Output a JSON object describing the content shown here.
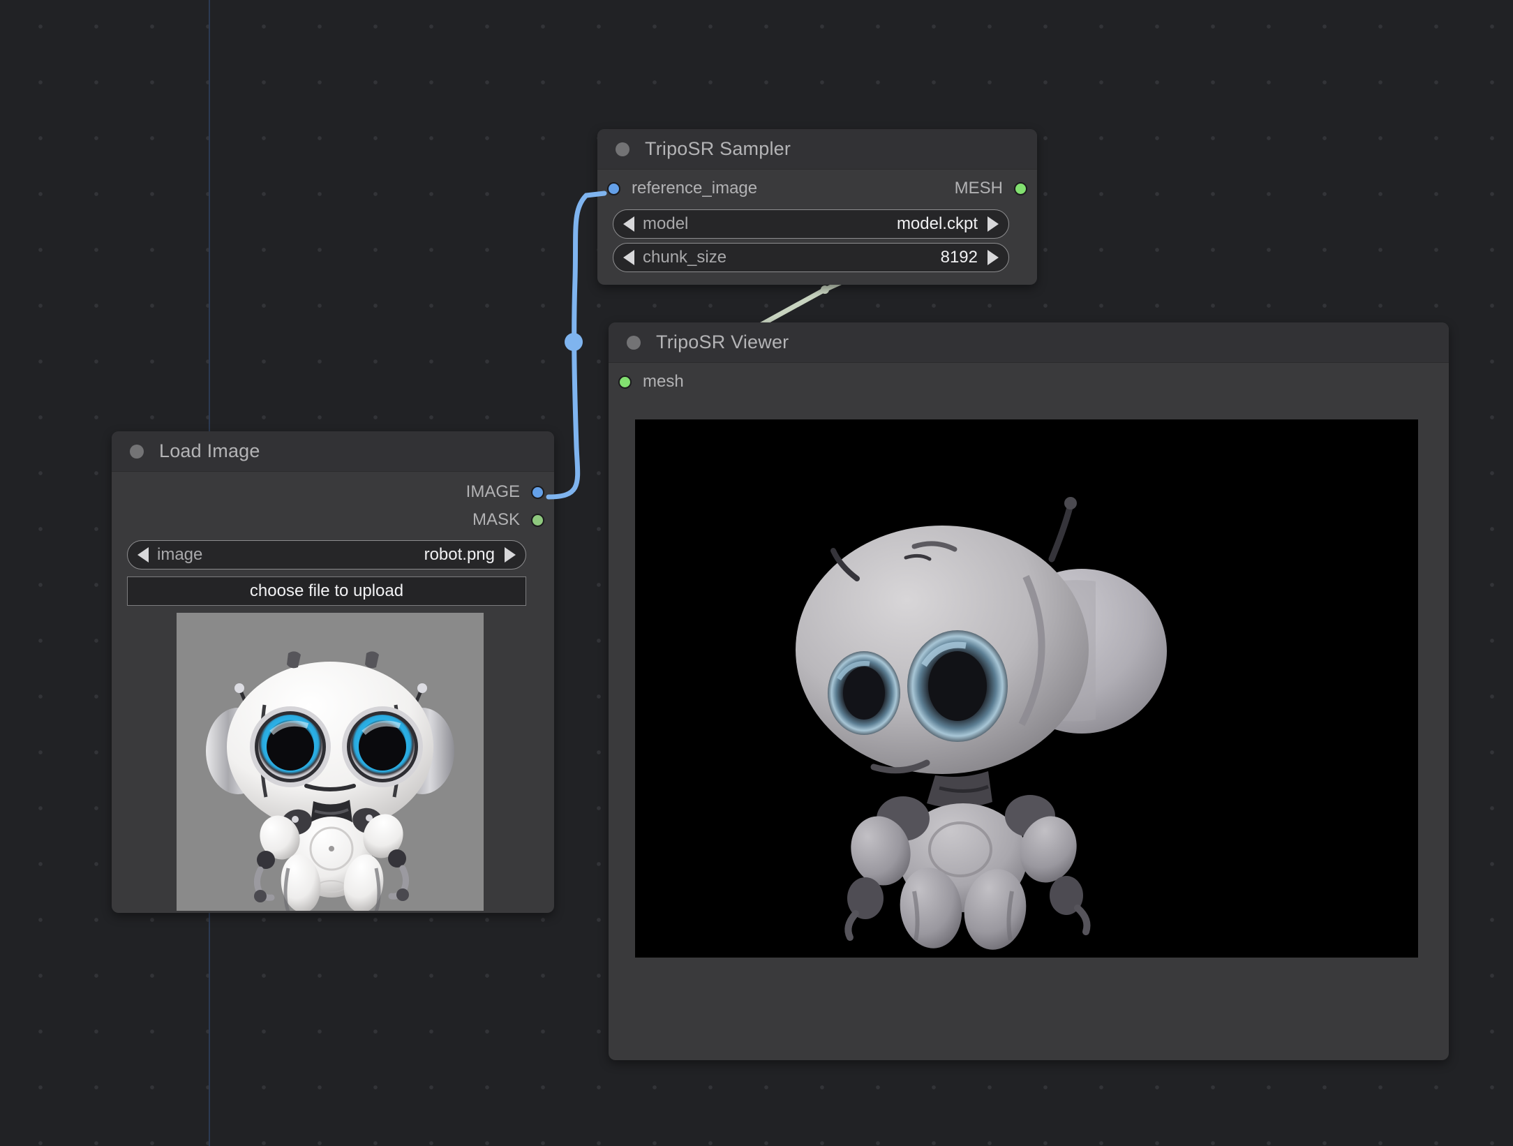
{
  "app": {
    "kind": "node-graph-editor",
    "canvas_bg": "#212225",
    "grid_dot_color": "#333438",
    "guide_line_color": "#2c3a52"
  },
  "nodes": [
    {
      "id": "triposr-sampler",
      "title": "TripoSR Sampler",
      "inputs": [
        {
          "name": "reference_image",
          "type": "IMAGE",
          "color": "#64a0e8"
        }
      ],
      "outputs": [
        {
          "name": "MESH",
          "type": "MESH",
          "color": "#82e070"
        }
      ],
      "widgets": [
        {
          "name": "model",
          "value": "model.ckpt"
        },
        {
          "name": "chunk_size",
          "value": "8192"
        }
      ]
    },
    {
      "id": "load-image",
      "title": "Load Image",
      "inputs": [],
      "outputs": [
        {
          "name": "IMAGE",
          "type": "IMAGE",
          "color": "#64a0e8"
        },
        {
          "name": "MASK",
          "type": "MASK",
          "color": "#8ec87e"
        }
      ],
      "widgets": [
        {
          "name": "image",
          "value": "robot.png"
        }
      ],
      "buttons": [
        {
          "label": "choose file to upload"
        }
      ],
      "preview": {
        "alt": "robot.png preview",
        "background": "#8a8a8a"
      }
    },
    {
      "id": "triposr-viewer",
      "title": "TripoSR Viewer",
      "inputs": [
        {
          "name": "mesh",
          "type": "MESH",
          "color": "#82e070"
        }
      ],
      "outputs": [],
      "widgets": [],
      "viewport": {
        "alt": "3D mesh preview",
        "background": "#000000"
      }
    }
  ],
  "links": [
    {
      "from": "load-image.IMAGE",
      "to": "triposr-sampler.reference_image",
      "color": "#7fb4ef"
    },
    {
      "from": "triposr-sampler.MESH",
      "to": "triposr-viewer.mesh",
      "color": "#c8d4c0"
    }
  ]
}
